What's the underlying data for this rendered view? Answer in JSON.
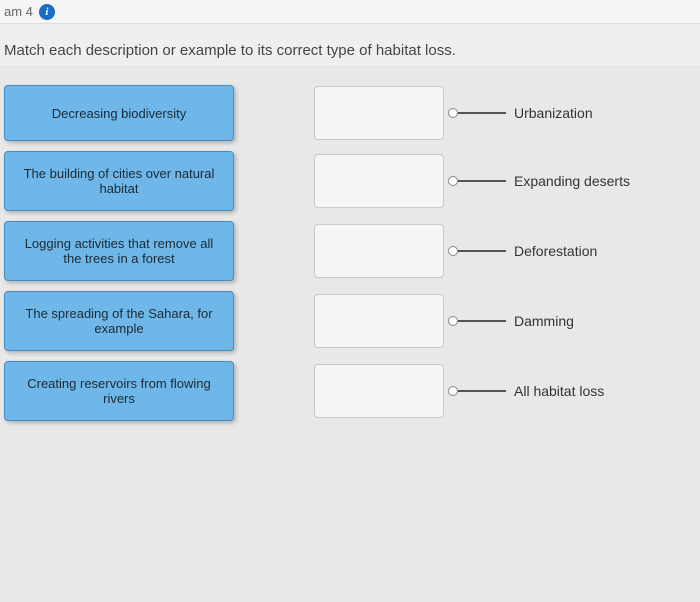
{
  "header": {
    "crumb": "am 4",
    "info_icon": "i"
  },
  "instruction": "Match each description or example to its correct type of habitat loss.",
  "sources": [
    {
      "label": "Decreasing biodiversity"
    },
    {
      "label": "The building of cities over natural habitat"
    },
    {
      "label": "Logging activities that remove all the trees in a forest"
    },
    {
      "label": "The spreading of the Sahara, for example"
    },
    {
      "label": "Creating reservoirs from flowing rivers"
    }
  ],
  "targets": [
    {
      "label": "Urbanization"
    },
    {
      "label": "Expanding deserts"
    },
    {
      "label": "Deforestation"
    },
    {
      "label": "Damming"
    },
    {
      "label": "All habitat loss"
    }
  ]
}
